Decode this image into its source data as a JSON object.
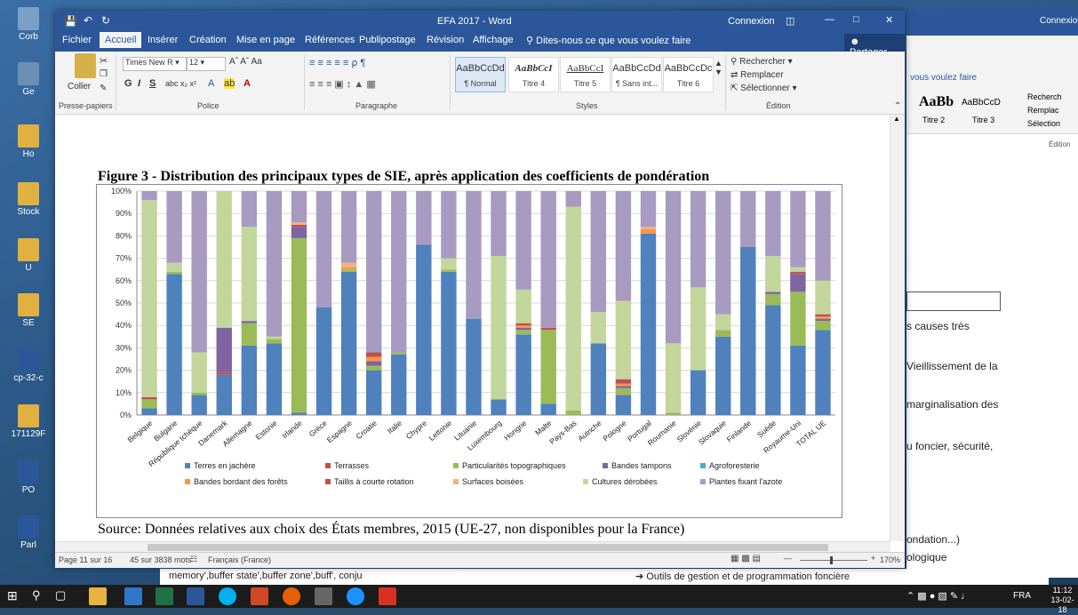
{
  "window": {
    "title": "EFA 2017 - Word",
    "signin": "Connexion",
    "share": "Partager"
  },
  "tabs": [
    "Fichier",
    "Accueil",
    "Insérer",
    "Création",
    "Mise en page",
    "Références",
    "Publipostage",
    "Révision",
    "Affichage"
  ],
  "tellme": "Dites-nous ce que vous voulez faire",
  "ribbon": {
    "paste": "Coller",
    "font_name": "Times New R",
    "font_size": "12",
    "groups": {
      "clipboard": "Presse-papiers",
      "font": "Police",
      "paragraph": "Paragraphe",
      "styles": "Styles",
      "editing": "Édition"
    },
    "styles": [
      {
        "preview": "AaBbCcDd",
        "name": "¶ Normal"
      },
      {
        "preview": "AaBbCcI",
        "name": "Titre 4"
      },
      {
        "preview": "AaBbCcI",
        "name": "Titre 5"
      },
      {
        "preview": "AaBbCcDd",
        "name": "¶ Sans int..."
      },
      {
        "preview": "AaBbCcDc",
        "name": "Titre 6"
      }
    ],
    "editing": {
      "find": "Rechercher",
      "replace": "Remplacer",
      "select": "Sélectionner"
    }
  },
  "figure": {
    "title": "Figure 3 - Distribution des principaux types de SIE, après application des coefficients de pondération",
    "source": "Source: Données relatives aux choix des États membres, 2015 (UE-27, non disponibles pour la France)"
  },
  "chart_data": {
    "type": "bar",
    "stacked": true,
    "ylim": [
      0,
      100
    ],
    "yticks": [
      "0%",
      "10%",
      "20%",
      "30%",
      "40%",
      "50%",
      "60%",
      "70%",
      "80%",
      "90%",
      "100%"
    ],
    "categories": [
      "Belgique",
      "Bulgarie",
      "République tchèque",
      "Danemark",
      "Allemagne",
      "Estonie",
      "Irlande",
      "Grèce",
      "Espagne",
      "Croatie",
      "Italie",
      "Chypre",
      "Lettonie",
      "Lituanie",
      "Luxembourg",
      "Hongrie",
      "Malte",
      "Pays-Bas",
      "Autriche",
      "Pologne",
      "Portugal",
      "Roumanie",
      "Slovénie",
      "Slovaquie",
      "Finlande",
      "Suède",
      "Royaume-Uni",
      "TOTAL UE"
    ],
    "series": [
      {
        "name": "Terres en jachère",
        "color": "#4f81bd",
        "values": [
          3,
          63,
          9,
          18,
          31,
          32,
          1,
          48,
          64,
          20,
          27,
          76,
          64,
          43,
          7,
          36,
          5,
          0,
          32,
          9,
          81,
          0,
          20,
          35,
          75,
          49,
          31,
          38
        ]
      },
      {
        "name": "Terrasses",
        "color": "#c0504d",
        "values": [
          0,
          0,
          0,
          1,
          0,
          0,
          0,
          0,
          0,
          0,
          0,
          0,
          0,
          0,
          0,
          0,
          0,
          0,
          0,
          0,
          0,
          0,
          0,
          0,
          0,
          0,
          0,
          0
        ]
      },
      {
        "name": "Particularités topographiques",
        "color": "#9bbb59",
        "values": [
          4,
          1,
          1,
          0,
          10,
          2,
          78,
          0,
          1,
          2,
          1,
          0,
          1,
          0,
          0,
          2,
          33,
          2,
          0,
          3,
          0,
          1,
          0,
          3,
          0,
          5,
          24,
          4
        ]
      },
      {
        "name": "Bandes tampons",
        "color": "#8064a2",
        "values": [
          0,
          0,
          0,
          20,
          1,
          0,
          5,
          0,
          0,
          2,
          0,
          0,
          0,
          0,
          0,
          1,
          0,
          0,
          0,
          1,
          0,
          0,
          0,
          0,
          0,
          1,
          8,
          1
        ]
      },
      {
        "name": "Agroforesterie",
        "color": "#4bacc6",
        "values": [
          0,
          0,
          0,
          0,
          0,
          0,
          0,
          0,
          0,
          0,
          0,
          0,
          0,
          0,
          0,
          0,
          0,
          0,
          0,
          0,
          0,
          0,
          0,
          0,
          0,
          0,
          0,
          0
        ]
      },
      {
        "name": "Bandes bordant des forêts",
        "color": "#f79646",
        "values": [
          0,
          0,
          0,
          0,
          0,
          0,
          0,
          0,
          1,
          2,
          0,
          0,
          0,
          0,
          0,
          1,
          0,
          0,
          0,
          1,
          2,
          0,
          0,
          0,
          0,
          0,
          0,
          1
        ]
      },
      {
        "name": "Taillis à courte rotation",
        "color": "#c0504d",
        "values": [
          1,
          0,
          0,
          0,
          0,
          0,
          1,
          0,
          0,
          2,
          0,
          0,
          0,
          0,
          0,
          1,
          1,
          0,
          0,
          2,
          0,
          0,
          0,
          0,
          0,
          0,
          1,
          1
        ]
      },
      {
        "name": "Surfaces boisées",
        "color": "#f4b183",
        "values": [
          0,
          0,
          0,
          0,
          0,
          0,
          1,
          0,
          2,
          0,
          0,
          0,
          0,
          0,
          0,
          0,
          0,
          0,
          0,
          0,
          1,
          0,
          0,
          0,
          0,
          0,
          0,
          0
        ]
      },
      {
        "name": "Cultures dérobées",
        "color": "#c3d69b",
        "values": [
          88,
          4,
          18,
          61,
          42,
          1,
          0,
          0,
          0,
          0,
          0,
          0,
          5,
          0,
          64,
          15,
          0,
          91,
          14,
          35,
          0,
          31,
          37,
          7,
          0,
          16,
          2,
          15
        ]
      },
      {
        "name": "Plantes fixant l'azote",
        "color": "#a79bc2",
        "values": [
          4,
          32,
          72,
          0,
          16,
          65,
          14,
          52,
          32,
          72,
          72,
          24,
          30,
          57,
          29,
          44,
          61,
          7,
          54,
          49,
          16,
          68,
          43,
          55,
          25,
          29,
          34,
          40
        ]
      }
    ]
  },
  "status": {
    "page": "Page 11 sur 16",
    "words": "45 sur 3838 mots",
    "language": "Français (France)",
    "zoom": "170%"
  },
  "background_window": {
    "tellme": "vous voulez faire",
    "signin": "Connexion",
    "style_previews": [
      "AaBb",
      "AaBbCcD"
    ],
    "style_names": [
      "Titre 2",
      "Titre 3"
    ],
    "find": "Recherch",
    "replace": "Remplac",
    "select": "Sélection",
    "group": "Édition",
    "lines": [
      "s causes très",
      "Vieillissement de la",
      "marginalisation des",
      "u foncier, sécurité,",
      "ondation...)",
      "ologique"
    ]
  },
  "background_strip": {
    "text1": "memory',buffer state',buffer zone',buff', conju",
    "text2": "➔ Outils de gestion et de programmation foncière"
  },
  "desktop_icons": [
    "Corb",
    "Ge",
    "Ho",
    "Stock",
    "U",
    "SE",
    "cp-32-c",
    "171129F",
    "PO",
    "Parl"
  ],
  "taskbar": {
    "language": "FRA",
    "time": "11:12",
    "date": "13-02-18"
  }
}
